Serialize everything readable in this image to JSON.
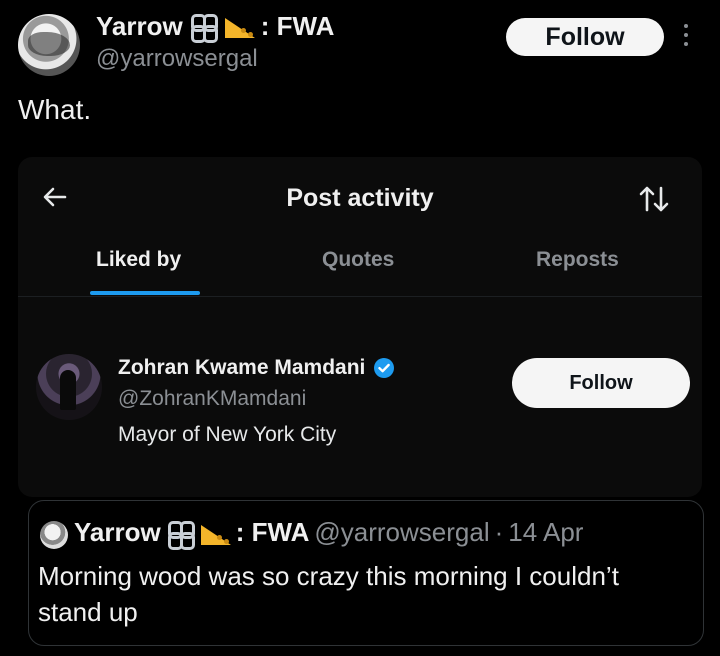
{
  "post": {
    "author_name": "Yarrow",
    "author_name_suffix": ": FWA",
    "author_handle": "@yarrowsergal",
    "follow_label": "Follow",
    "text": "What."
  },
  "post_activity": {
    "title": "Post activity",
    "tabs": [
      {
        "label": "Liked by",
        "selected": true
      },
      {
        "label": "Quotes",
        "selected": false
      },
      {
        "label": "Reposts",
        "selected": false
      }
    ],
    "accent_color": "#1d9bf0"
  },
  "liker": {
    "name": "Zohran Kwame Mamdani",
    "handle": "@ZohranKMamdani",
    "bio": "Mayor of New York City",
    "follow_label": "Follow",
    "verified": true
  },
  "quoted_post": {
    "author_name": "Yarrow",
    "author_name_suffix": ": FWA",
    "author_handle": "@yarrowsergal",
    "separator": "·",
    "date": "14 Apr",
    "text": "Morning wood was so crazy this morning I couldn’t stand up"
  },
  "icons": [
    "chain-icon",
    "cheese-icon",
    "back-arrow-icon",
    "sort-icon",
    "verified-badge-icon",
    "more-options-icon"
  ]
}
